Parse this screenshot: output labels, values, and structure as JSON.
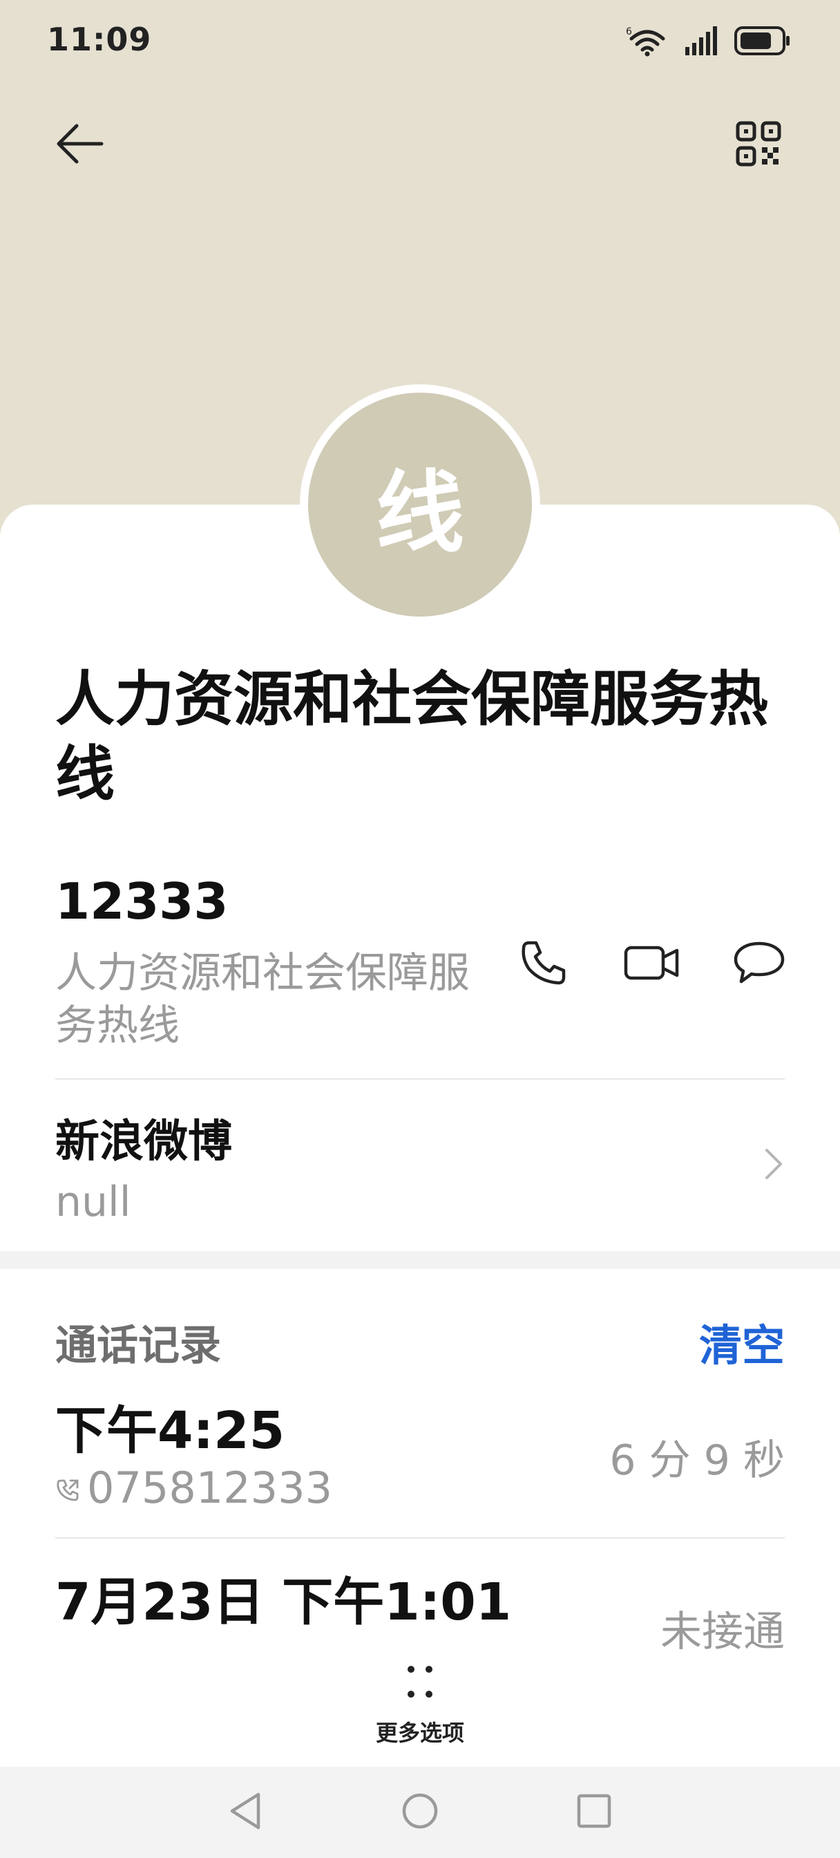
{
  "status_bar": {
    "time": "11:09",
    "icons": [
      "wifi-icon",
      "signal-icon",
      "battery-icon"
    ]
  },
  "header": {
    "back_icon": "arrow-left-icon",
    "qr_icon": "qr-code-icon",
    "background_color": "#e5e0d0"
  },
  "contact": {
    "avatar_letter": "线",
    "avatar_color": "#d0cbb5",
    "name": "人力资源和社会保障服务热线"
  },
  "phone": {
    "number": "12333",
    "label": "人力资源和社会保障服务热线",
    "actions": [
      "phone-icon",
      "video-call-icon",
      "message-icon"
    ]
  },
  "weibo": {
    "title": "新浪微博",
    "value": "null"
  },
  "call_log": {
    "title": "通话记录",
    "clear_label": "清空",
    "accent_color": "#1f63d6",
    "entries": [
      {
        "time": "下午4:25",
        "number": "075812333",
        "status": "6 分 9 秒"
      },
      {
        "time": "7月23日 下午1:01",
        "status": "未接通"
      }
    ]
  },
  "more_options": {
    "label": "更多选项"
  },
  "nav_bar": {
    "buttons": [
      "back-triangle-icon",
      "home-circle-icon",
      "recents-square-icon"
    ]
  }
}
